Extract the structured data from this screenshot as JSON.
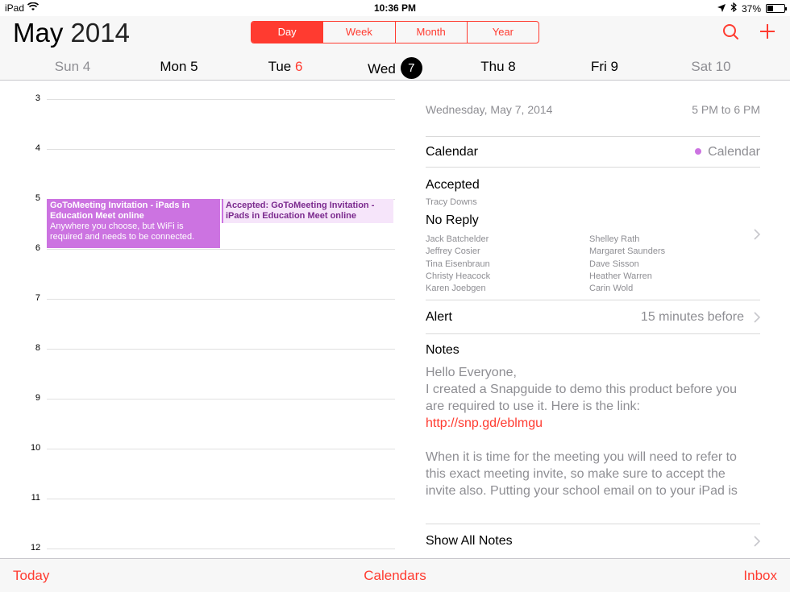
{
  "status": {
    "device": "iPad",
    "time": "10:36 PM",
    "battery": "37%",
    "battery_level": 0.37
  },
  "header": {
    "month": "May",
    "year": "2014",
    "segments": [
      "Day",
      "Week",
      "Month",
      "Year"
    ],
    "active_segment": "Day",
    "accent_color": "#ff3b30"
  },
  "days": [
    {
      "label": "Sun 4"
    },
    {
      "label": "Mon 5"
    },
    {
      "label": "Tue",
      "num": "6"
    },
    {
      "label": "Wed",
      "num": "7"
    },
    {
      "label": "Thu 8"
    },
    {
      "label": "Fri 9"
    },
    {
      "label": "Sat 10"
    }
  ],
  "timeline": {
    "hours": [
      "3",
      "4",
      "5",
      "6",
      "7",
      "8",
      "9",
      "10",
      "11",
      "12"
    ],
    "events": [
      {
        "title": "GoToMeeting Invitation - iPads in Education Meet online",
        "detail": "Anywhere you choose, but WiFi is required and needs to be connected.",
        "color": "#cc73e1"
      },
      {
        "title": "Accepted: GoToMeeting Invitation - iPads in Education Meet online",
        "color": "#f6e5fa"
      }
    ]
  },
  "details": {
    "date": "Wednesday, May 7, 2014",
    "time": "5 PM to 6 PM",
    "calendar_label": "Calendar",
    "calendar_value": "Calendar",
    "accepted_label": "Accepted",
    "accepted_person": "Tracy Downs",
    "noreply_label": "No Reply",
    "invitees_left": [
      "Jack Batchelder",
      "Jeffrey Cosier",
      "Tina Eisenbraun",
      "Christy Heacock",
      "Karen Joebgen"
    ],
    "invitees_right": [
      "Shelley Rath",
      "Margaret Saunders",
      "Dave Sisson",
      "Heather Warren",
      "Carin Wold"
    ],
    "alert_label": "Alert",
    "alert_value": "15 minutes before",
    "notes_label": "Notes",
    "notes_line1": "Hello Everyone,",
    "notes_line2": "I created a Snapguide to demo this product before you are required to use it.  Here is the link: ",
    "notes_link": "http://snp.gd/eblmgu",
    "notes_line3": "When it is time for the meeting you will need to refer to this exact meeting invite, so make sure to accept the invite also.  Putting your school email on to your iPad is",
    "show_all_notes": "Show All Notes"
  },
  "tabbar": {
    "today": "Today",
    "calendars": "Calendars",
    "inbox": "Inbox"
  }
}
